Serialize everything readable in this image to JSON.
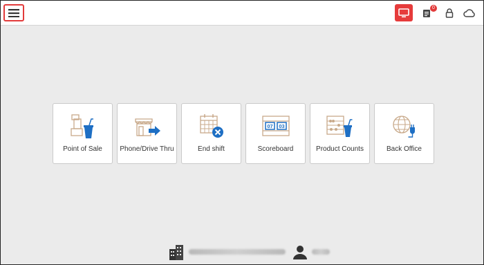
{
  "colors": {
    "accent": "#e63b3b",
    "icon_blue": "#1e6fc4",
    "icon_tan": "#c8a98a"
  },
  "topbar": {
    "menu_icon": "hamburger-menu-icon",
    "right_icons": [
      "display-icon",
      "orders-icon",
      "lock-icon",
      "cloud-icon"
    ],
    "orders_badge": "0"
  },
  "tiles": [
    {
      "label": "Point of Sale",
      "icon": "point-of-sale-icon"
    },
    {
      "label": "Phone/Drive Thru",
      "icon": "phone-drive-thru-icon"
    },
    {
      "label": "End shift",
      "icon": "end-shift-icon"
    },
    {
      "label": "Scoreboard",
      "icon": "scoreboard-icon",
      "digits": [
        "07",
        "03"
      ]
    },
    {
      "label": "Product Counts",
      "icon": "product-counts-icon"
    },
    {
      "label": "Back Office",
      "icon": "back-office-icon"
    }
  ],
  "footer": {
    "store_icon": "store-building-icon",
    "user_icon": "user-icon"
  }
}
